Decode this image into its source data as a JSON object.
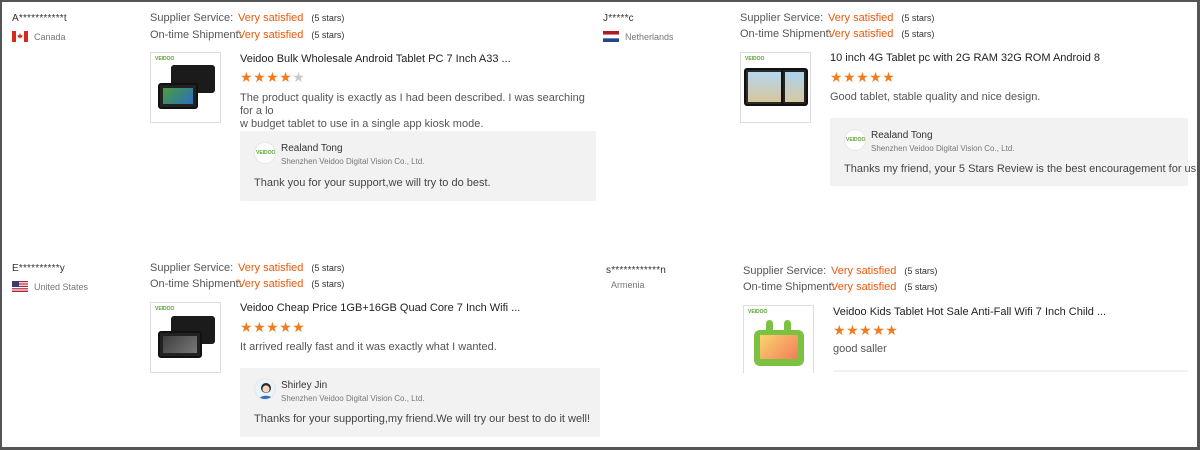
{
  "labels": {
    "supplier_service": "Supplier Service:",
    "on_time_shipment": "On-time Shipment:"
  },
  "colors": {
    "accent": "#e8590c",
    "star": "#f07c1d",
    "reply_bg": "#f2f2f2"
  },
  "reviews": [
    {
      "buyer": "A***********t",
      "country": "Canada",
      "flag_icon": "canada-flag-icon",
      "supplier_service": "Very satisfied",
      "supplier_service_stars": "(5 stars)",
      "shipment": "Very satisfied",
      "shipment_stars": "(5 stars)",
      "product_title": "Veidoo Bulk Wholesale Android Tablet PC 7 Inch A33 ...",
      "rating": 4,
      "text_line1": "The product quality is exactly as I had been described. I was searching for a lo",
      "text_line2": "w budget tablet to use in a single app kiosk mode.",
      "reply_name": "Realand Tong",
      "reply_company": "Shenzhen Veidoo Digital Vision Co., Ltd.",
      "reply_text": "Thank you for your support,we will try to do best.",
      "thumb_brand": "VEIDOO",
      "avatar_brand": "VEIDOO"
    },
    {
      "buyer": "J*****c",
      "country": "Netherlands",
      "flag_icon": "netherlands-flag-icon",
      "supplier_service": "Very satisfied",
      "supplier_service_stars": "(5 stars)",
      "shipment": "Very satisfied",
      "shipment_stars": "(5 stars)",
      "product_title": "10 inch 4G Tablet pc with 2G RAM 32G ROM Android 8",
      "rating": 5,
      "text_line1": "Good tablet, stable quality and nice design.",
      "reply_name": "Realand Tong",
      "reply_company": "Shenzhen Veidoo Digital Vision Co., Ltd.",
      "reply_text": "Thanks my friend, your 5 Stars Review is the best encouragement for us.",
      "thumb_brand": "VEIDOO",
      "avatar_brand": "VEIDOO"
    },
    {
      "buyer": "E**********y",
      "country": "United States",
      "flag_icon": "usa-flag-icon",
      "supplier_service": "Very satisfied",
      "supplier_service_stars": "(5 stars)",
      "shipment": "Very satisfied",
      "shipment_stars": "(5 stars)",
      "product_title": "Veidoo Cheap Price 1GB+16GB Quad Core 7 Inch Wifi ...",
      "rating": 5,
      "text_line1": "It arrived really fast and it was exactly what I wanted.",
      "reply_name": "Shirley Jin",
      "reply_company": "Shenzhen Veidoo Digital Vision Co., Ltd.",
      "reply_text": "Thanks for your supporting,my friend.We will try our best to do it well!",
      "thumb_brand": "VEIDOO"
    },
    {
      "buyer": "s************n",
      "country": "Armenia",
      "supplier_service": "Very satisfied",
      "supplier_service_stars": "(5 stars)",
      "shipment": "Very satisfied",
      "shipment_stars": "(5 stars)",
      "product_title": "Veidoo Kids Tablet Hot Sale Anti-Fall Wifi 7 Inch Child ...",
      "rating": 5,
      "text_line1": "good saller",
      "thumb_brand": "VEIDOO"
    }
  ]
}
